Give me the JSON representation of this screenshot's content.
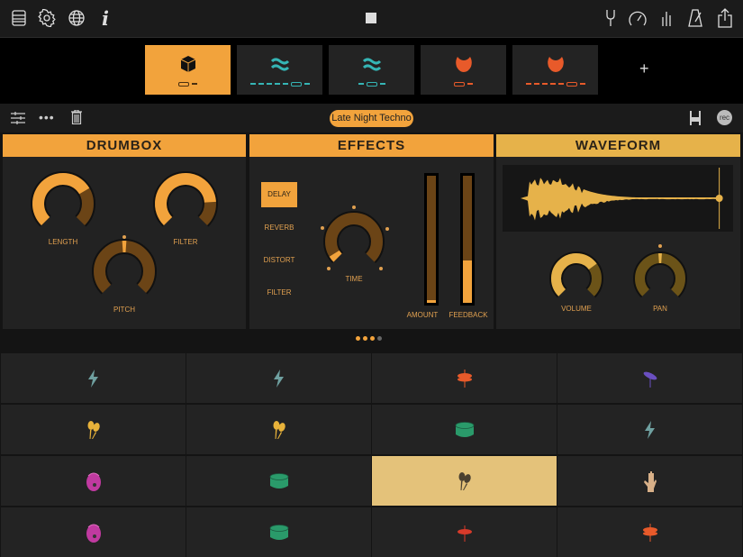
{
  "topbar": {
    "left_icons": [
      "library-icon",
      "settings-gear-icon",
      "globe-icon",
      "info-icon"
    ],
    "center_icon": "stop-icon",
    "right_icons": [
      "tuning-fork-icon",
      "tempo-gauge-icon",
      "mixer-levels-icon",
      "metronome-icon",
      "share-icon"
    ],
    "info_glyph": "i"
  },
  "tracks": [
    {
      "icon": "cube-icon",
      "color": "#111111",
      "selected": true,
      "seq_color": "#4a3010"
    },
    {
      "icon": "waves-icon",
      "color": "#35b5b5",
      "selected": false,
      "seq_color": "#35b5b5"
    },
    {
      "icon": "waves-icon",
      "color": "#35b5b5",
      "selected": false,
      "seq_color": "#35b5b5"
    },
    {
      "icon": "bulb-icon",
      "color": "#e85a2a",
      "selected": false,
      "seq_color": "#e85a2a"
    },
    {
      "icon": "bulb-icon",
      "color": "#e85a2a",
      "selected": false,
      "seq_color": "#e85a2a"
    }
  ],
  "add_track_label": "+",
  "toolbar": {
    "preset": "Late Night Techno",
    "rec_label": "rec"
  },
  "drumbox": {
    "title": "DRUMBOX",
    "knobs": [
      {
        "label": "LENGTH",
        "value": 0.72
      },
      {
        "label": "FILTER",
        "value": 0.82
      },
      {
        "label": "PITCH",
        "value": 0.5
      }
    ]
  },
  "effects": {
    "title": "EFFECTS",
    "tabs": [
      "DELAY",
      "REVERB",
      "DISTORT",
      "FILTER"
    ],
    "selected_tab": "DELAY",
    "time": {
      "label": "TIME",
      "value": 0.05
    },
    "faders": [
      {
        "label": "AMOUNT",
        "value": 0.02
      },
      {
        "label": "FEEDBACK",
        "value": 0.33
      }
    ]
  },
  "waveform": {
    "title": "WAVEFORM",
    "playhead": 0.94,
    "knobs": [
      {
        "label": "VOLUME",
        "value": 0.7
      },
      {
        "label": "PAN",
        "value": 0.5
      }
    ]
  },
  "page_dots": {
    "count": 4,
    "active": [
      0,
      1,
      2
    ]
  },
  "colors": {
    "accent": "#f2a33c",
    "waveform_accent": "#e6b24a"
  },
  "pads": [
    {
      "icon": "lightning-icon",
      "color": "#6fa0a0"
    },
    {
      "icon": "lightning-icon",
      "color": "#6fa0a0"
    },
    {
      "icon": "hihat-icon",
      "color": "#e85a2a"
    },
    {
      "icon": "cymbal-icon",
      "color": "#6a4fc0"
    },
    {
      "icon": "maracas-icon",
      "color": "#e8b23a"
    },
    {
      "icon": "maracas-icon",
      "color": "#e8b23a"
    },
    {
      "icon": "drum-icon",
      "color": "#2a9a6a"
    },
    {
      "icon": "lightning-icon",
      "color": "#6fa0a0"
    },
    {
      "icon": "shaker-icon",
      "color": "#c03aa0"
    },
    {
      "icon": "drum-icon",
      "color": "#2a9a6a"
    },
    {
      "icon": "maracas-icon",
      "color": "#4a4030",
      "active": true
    },
    {
      "icon": "hand-icon",
      "color": "#d8b088"
    },
    {
      "icon": "shaker-icon",
      "color": "#c03aa0"
    },
    {
      "icon": "drum-icon",
      "color": "#2a9a6a"
    },
    {
      "icon": "cymbal-red-icon",
      "color": "#d83a2a"
    },
    {
      "icon": "hihat-icon",
      "color": "#e85a2a"
    }
  ]
}
